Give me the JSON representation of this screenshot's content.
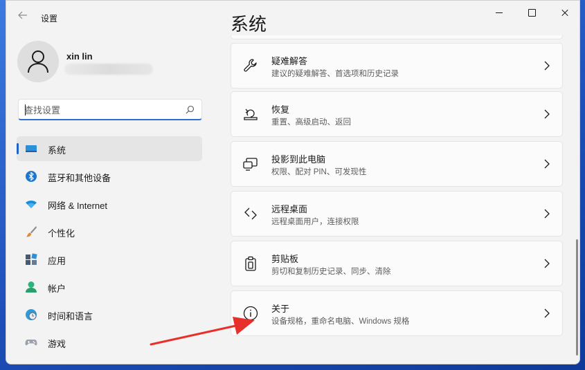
{
  "window": {
    "app_title": "设置"
  },
  "user": {
    "name": "xin lin"
  },
  "search": {
    "placeholder": "查找设置"
  },
  "nav": {
    "items": [
      {
        "label": "系统",
        "icon": "system-icon",
        "selected": true
      },
      {
        "label": "蓝牙和其他设备",
        "icon": "bluetooth-icon"
      },
      {
        "label": "网络 & Internet",
        "icon": "wifi-icon"
      },
      {
        "label": "个性化",
        "icon": "paintbrush-icon"
      },
      {
        "label": "应用",
        "icon": "apps-icon"
      },
      {
        "label": "帐户",
        "icon": "person-icon"
      },
      {
        "label": "时间和语言",
        "icon": "clock-globe-icon"
      },
      {
        "label": "游戏",
        "icon": "gamepad-icon"
      }
    ]
  },
  "main": {
    "title": "系统",
    "cards": [
      {
        "title": "疑难解答",
        "subtitle": "建议的疑难解答、首选项和历史记录",
        "icon": "wrench-icon"
      },
      {
        "title": "恢复",
        "subtitle": "重置、高级启动、返回",
        "icon": "recovery-icon"
      },
      {
        "title": "投影到此电脑",
        "subtitle": "权限、配对 PIN、可发现性",
        "icon": "project-icon"
      },
      {
        "title": "远程桌面",
        "subtitle": "远程桌面用户，连接权限",
        "icon": "remote-desktop-icon"
      },
      {
        "title": "剪贴板",
        "subtitle": "剪切和复制历史记录、同步、清除",
        "icon": "clipboard-icon"
      },
      {
        "title": "关于",
        "subtitle": "设备规格，重命名电脑、Windows 规格",
        "icon": "info-icon"
      }
    ]
  },
  "colors": {
    "accent": "#1f63c8",
    "annotation_arrow": "#e8302b"
  }
}
